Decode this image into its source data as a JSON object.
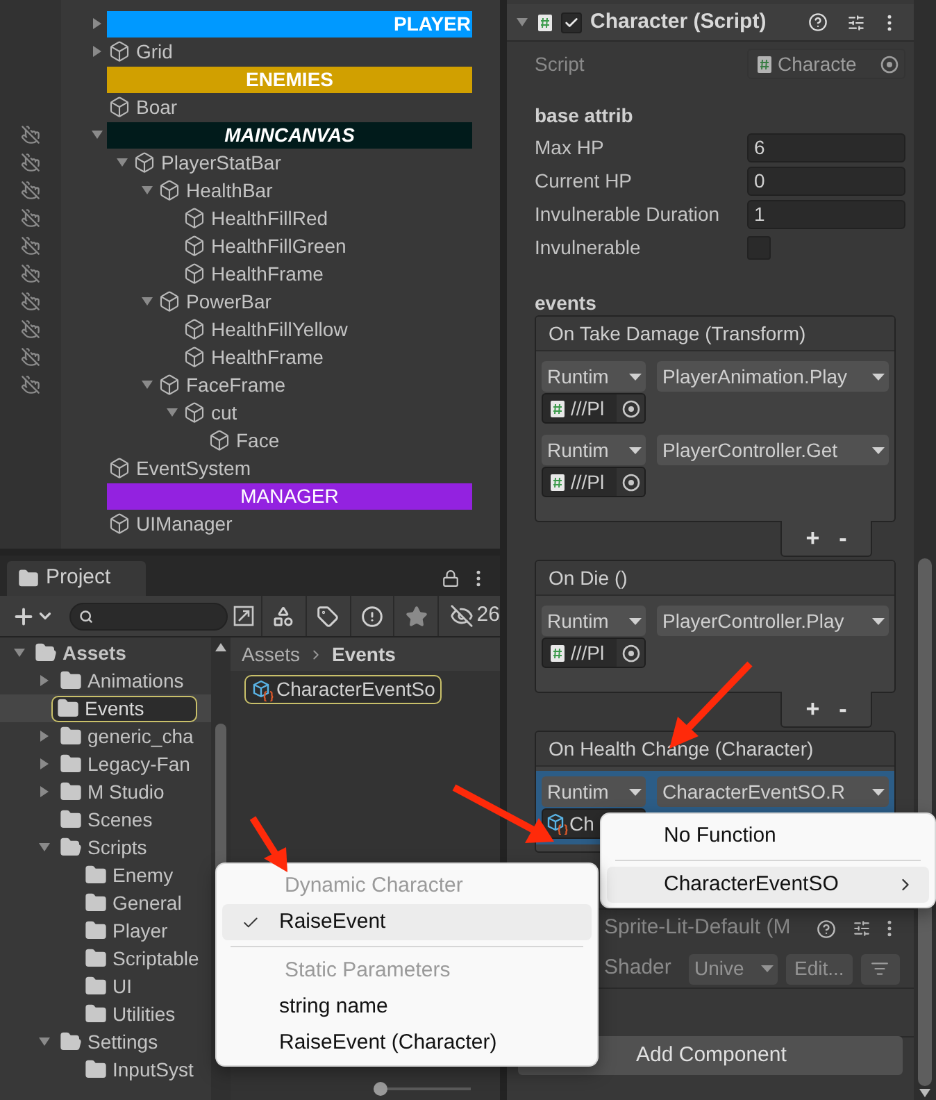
{
  "hierarchy": {
    "items": [
      {
        "kind": "header",
        "label": "PLAYER",
        "color": "#0099ff",
        "align_right": true,
        "bold": true,
        "italic": false,
        "expanded": false,
        "pickable": true
      },
      {
        "kind": "object",
        "label": "Grid",
        "expanded": false,
        "pickable": true
      },
      {
        "kind": "header",
        "label": "ENEMIES",
        "color": "#d1a000",
        "align_right": false,
        "bold": true,
        "italic": false,
        "pickable": true
      },
      {
        "kind": "object",
        "label": "Boar",
        "pickable": true
      },
      {
        "kind": "header",
        "label": "MAINCANVAS",
        "color": "#011b1b",
        "align_right": false,
        "bold": true,
        "italic": true,
        "expanded": true,
        "pickable": false,
        "children": [
          {
            "kind": "object",
            "label": "PlayerStatBar",
            "expanded": true,
            "pickable": false,
            "children": [
              {
                "kind": "object",
                "label": "HealthBar",
                "expanded": true,
                "pickable": false,
                "children": [
                  {
                    "kind": "object",
                    "label": "HealthFillRed",
                    "pickable": false
                  },
                  {
                    "kind": "object",
                    "label": "HealthFillGreen",
                    "pickable": false
                  },
                  {
                    "kind": "object",
                    "label": "HealthFrame",
                    "pickable": false
                  }
                ]
              },
              {
                "kind": "object",
                "label": "PowerBar",
                "expanded": true,
                "pickable": false,
                "children": [
                  {
                    "kind": "object",
                    "label": "HealthFillYellow",
                    "pickable": false
                  },
                  {
                    "kind": "object",
                    "label": "HealthFrame",
                    "pickable": false
                  }
                ]
              },
              {
                "kind": "object",
                "label": "FaceFrame",
                "expanded": true,
                "pickable": false,
                "children": [
                  {
                    "kind": "object",
                    "label": "cut",
                    "expanded": true,
                    "pickable": true,
                    "children": [
                      {
                        "kind": "object",
                        "label": "Face",
                        "pickable": true
                      }
                    ]
                  }
                ]
              }
            ]
          }
        ]
      },
      {
        "kind": "object",
        "label": "EventSystem",
        "pickable": true
      },
      {
        "kind": "header",
        "label": "MANAGER",
        "color": "#9322e0",
        "align_right": false,
        "bold": false,
        "italic": false,
        "pickable": true
      },
      {
        "kind": "object",
        "label": "UIManager",
        "pickable": true
      }
    ]
  },
  "project": {
    "tabs": [
      {
        "label": "Project",
        "selected": true
      }
    ],
    "hidden_count": "26",
    "folders": [
      {
        "label": "Assets",
        "expanded": true,
        "selected": false,
        "children": [
          {
            "label": "Animations",
            "expanded": false,
            "selected": false
          },
          {
            "label": "Events",
            "selected": true
          },
          {
            "label": "generic_cha",
            "expanded": false,
            "selected": false
          },
          {
            "label": "Legacy-Fan",
            "expanded": false,
            "selected": false
          },
          {
            "label": "M Studio",
            "expanded": false,
            "selected": false
          },
          {
            "label": "Scenes",
            "selected": false
          },
          {
            "label": "Scripts",
            "expanded": true,
            "selected": false,
            "children": [
              {
                "label": "Enemy",
                "selected": false
              },
              {
                "label": "General",
                "selected": false
              },
              {
                "label": "Player",
                "selected": false
              },
              {
                "label": "Scriptable",
                "selected": false
              },
              {
                "label": "UI",
                "selected": false
              },
              {
                "label": "Utilities",
                "selected": false
              }
            ]
          },
          {
            "label": "Settings",
            "expanded": true,
            "selected": false,
            "children": [
              {
                "label": "InputSyst",
                "selected": false
              }
            ]
          }
        ]
      }
    ],
    "breadcrumb": [
      "Assets",
      "Events"
    ],
    "assets": [
      {
        "label": "CharacterEventSo",
        "selected": true
      }
    ],
    "zoom_slider": {
      "level": 0
    }
  },
  "inspector": {
    "component": {
      "title": "Character (Script)",
      "expanded": true,
      "enabled": true,
      "script": {
        "label": "Script",
        "value": "Characte",
        "disabled": true
      },
      "sections": [
        {
          "title": "base attrib",
          "fields": [
            {
              "kind": "number",
              "label": "Max HP",
              "value": "6"
            },
            {
              "kind": "number",
              "label": "Current HP",
              "value": "0"
            },
            {
              "kind": "number",
              "label": "Invulnerable Duration",
              "value": "1"
            },
            {
              "kind": "checkbox",
              "label": "Invulnerable",
              "checked": false
            }
          ]
        }
      ],
      "events_title": "events",
      "events": [
        {
          "title": "On Take Damage (Transform)",
          "add": "+",
          "remove": "-",
          "listeners": [
            {
              "kind": "script",
              "mode": "Runtim",
              "function": "PlayerAnimation.Play",
              "target": "///Pl",
              "selected": false
            },
            {
              "kind": "script",
              "mode": "Runtim",
              "function": "PlayerController.Get",
              "target": "///Pl",
              "selected": false
            }
          ]
        },
        {
          "title": "On Die ()",
          "add": "+",
          "remove": "-",
          "listeners": [
            {
              "kind": "script",
              "mode": "Runtim",
              "function": "PlayerController.Play",
              "target": "///Pl",
              "selected": false
            }
          ]
        },
        {
          "title": "On Health Change (Character)",
          "listeners": [
            {
              "kind": "scriptable",
              "mode": "Runtim",
              "function": "CharacterEventSO.R",
              "target": "Ch",
              "selected": true
            }
          ]
        }
      ]
    },
    "material": {
      "title": "Sprite-Lit-Default (M",
      "shader_label": "Shader",
      "shader_value": "Unive",
      "edit": "Edit..."
    },
    "add_component": "Add Component"
  },
  "function_menu": {
    "items": [
      {
        "kind": "item",
        "label": "No Function",
        "selected": false
      },
      {
        "kind": "separator"
      },
      {
        "kind": "submenu",
        "label": "CharacterEventSO",
        "selected": true
      }
    ]
  },
  "submenu": {
    "items": [
      {
        "kind": "heading",
        "label": "Dynamic Character"
      },
      {
        "kind": "item",
        "label": "RaiseEvent",
        "checked": true,
        "selected": true
      },
      {
        "kind": "separator"
      },
      {
        "kind": "heading",
        "label": "Static Parameters"
      },
      {
        "kind": "item",
        "label": "string name",
        "checked": false,
        "selected": false
      },
      {
        "kind": "item",
        "label": "RaiseEvent (Character)",
        "checked": false,
        "selected": false
      }
    ]
  }
}
